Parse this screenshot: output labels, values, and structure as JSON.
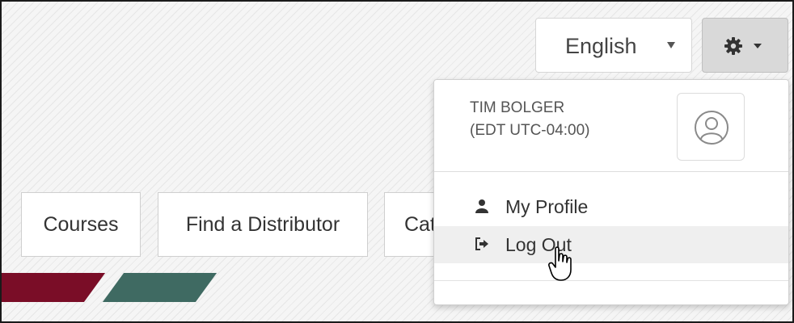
{
  "header": {
    "language": {
      "selected": "English"
    },
    "settings_button": {
      "icon": "gear-icon"
    }
  },
  "nav": {
    "items": [
      {
        "label": "Courses"
      },
      {
        "label": "Find a Distributor"
      },
      {
        "label": "Cat"
      }
    ]
  },
  "user_menu": {
    "name": "TIM BOLGER",
    "timezone": "(EDT UTC-04:00)",
    "avatar_icon": "user-circle-icon",
    "items": [
      {
        "label": "My Profile",
        "icon": "user-icon"
      },
      {
        "label": "Log Out",
        "icon": "sign-out-icon"
      }
    ]
  },
  "colors": {
    "brand_red": "#7a0d27",
    "brand_teal": "#3f6a62",
    "hover_bg": "#efefef"
  }
}
